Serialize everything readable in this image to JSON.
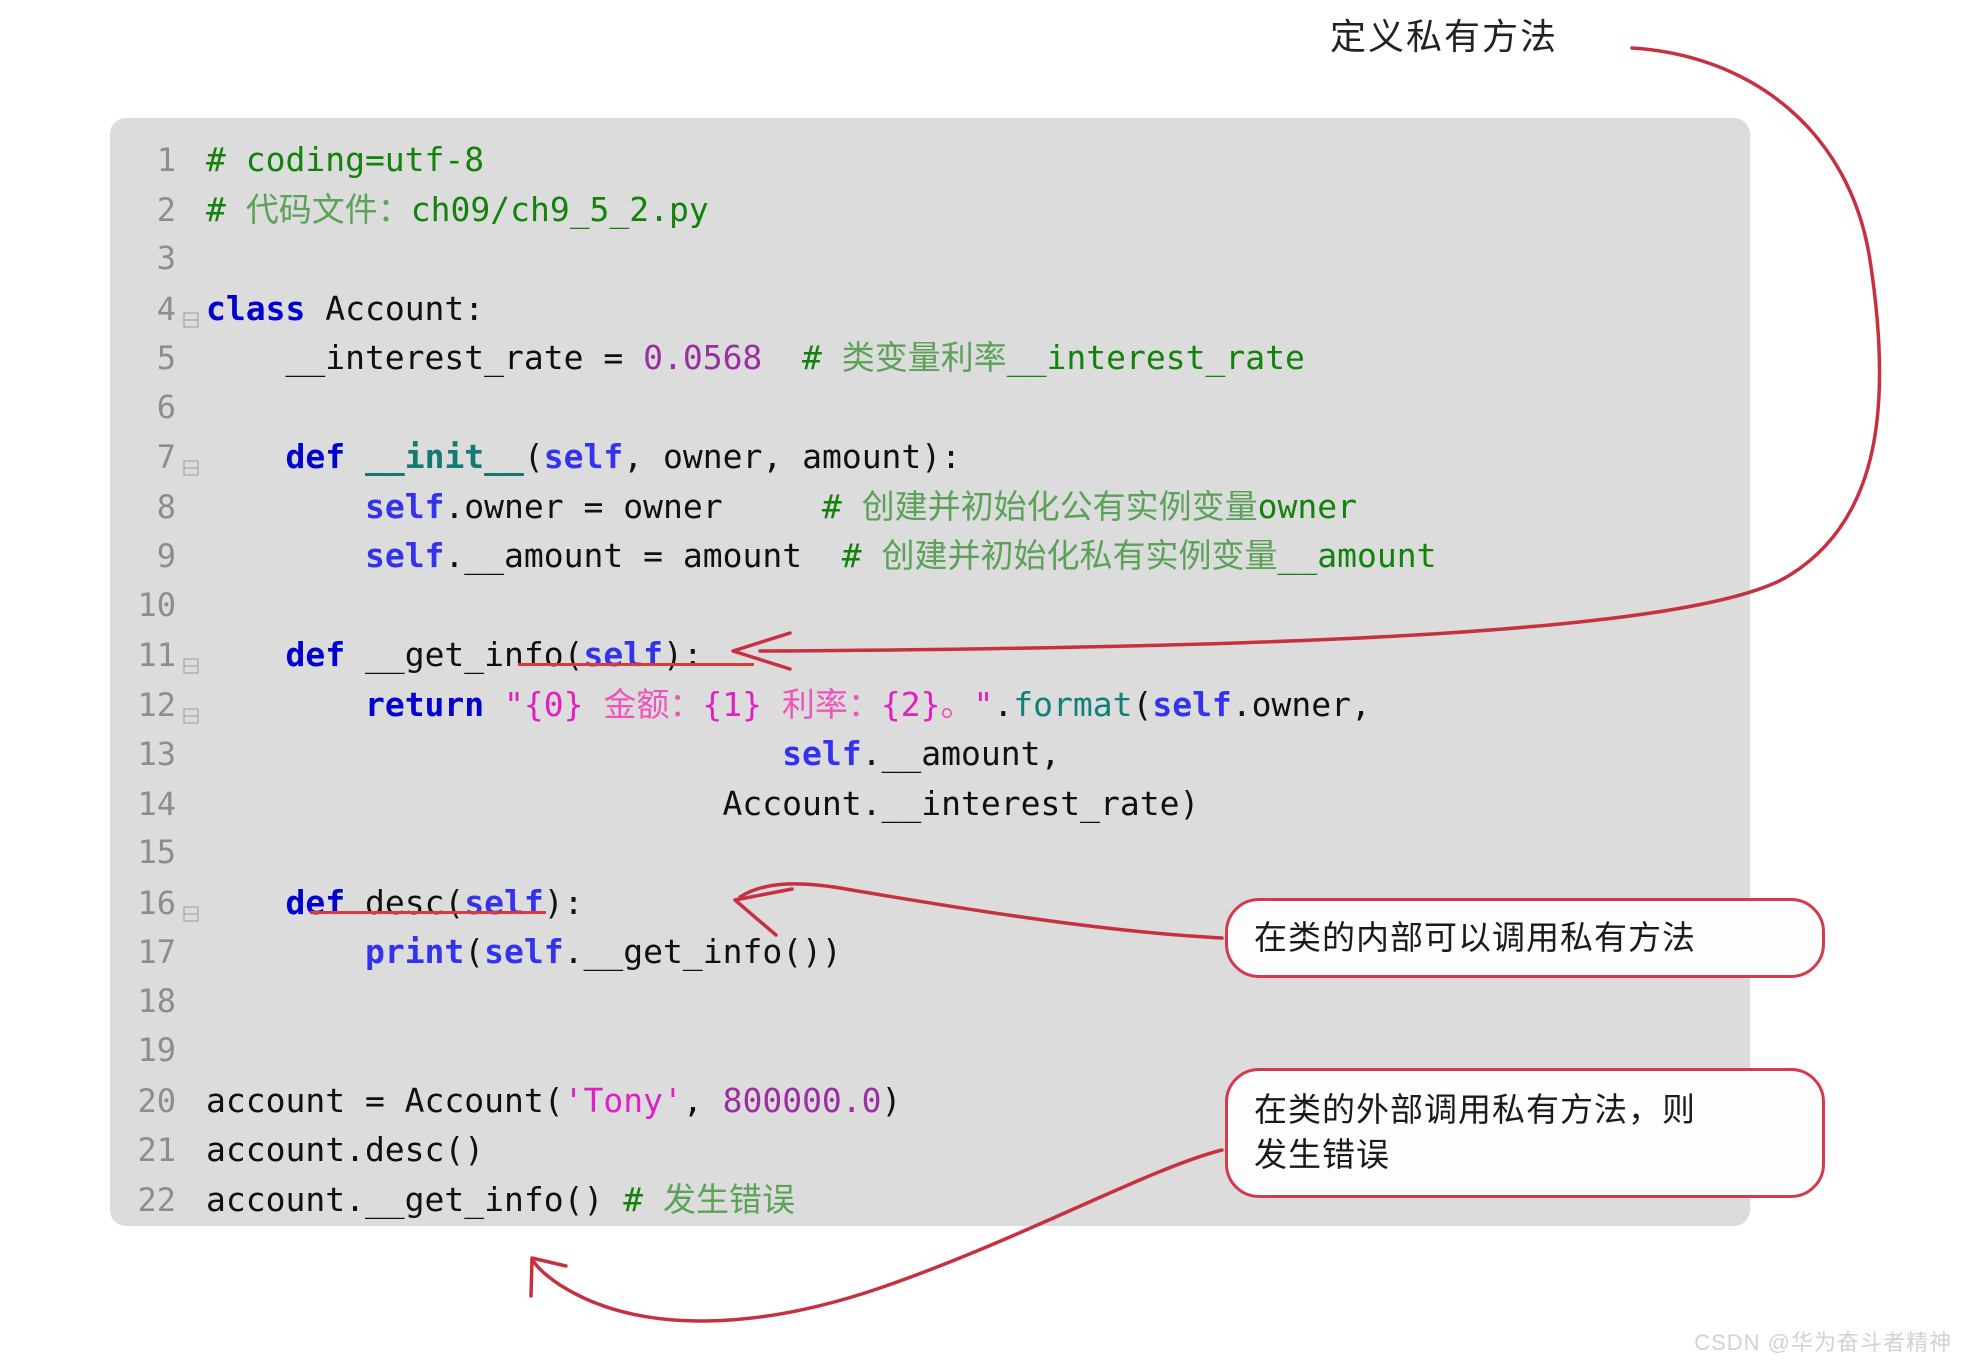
{
  "annotations": {
    "top_label": "定义私有方法",
    "callout_inner": "在类的内部可以调用私有方法",
    "callout_outer_line1": "在类的外部调用私有方法，则",
    "callout_outer_line2": "发生错误"
  },
  "watermark": "CSDN @华为奋斗者精神",
  "colors": {
    "panel_bg": "#dcdcdc",
    "page_bg": "#ffffff",
    "arrow_red": "#d53a4c",
    "underline_red": "#d93a3a",
    "keyword_blue": "#0000d0",
    "comment_green": "#13820a",
    "string_magenta": "#e020c0",
    "number_purple": "#9b2ea0",
    "self_blue": "#3333ee",
    "dunder_teal": "#117a72",
    "lineno_gray": "#8d8d8d"
  },
  "code": {
    "language": "python",
    "lines": [
      {
        "n": "1",
        "fold": false,
        "tokens": [
          {
            "t": "# coding=utf-8",
            "c": "t-comment"
          }
        ]
      },
      {
        "n": "2",
        "fold": false,
        "tokens": [
          {
            "t": "# ",
            "c": "t-comment"
          },
          {
            "t": "代码文件：",
            "c": "t-comment-cjk cjk"
          },
          {
            "t": "ch09/ch9_5_2.py",
            "c": "t-comment"
          }
        ]
      },
      {
        "n": "3",
        "fold": false,
        "tokens": []
      },
      {
        "n": "4",
        "fold": true,
        "tokens": [
          {
            "t": "class",
            "c": "t-kw"
          },
          {
            "t": " ",
            "c": "t-plain"
          },
          {
            "t": "Account",
            "c": "t-plain"
          },
          {
            "t": ":",
            "c": "t-plain"
          }
        ]
      },
      {
        "n": "5",
        "fold": false,
        "tokens": [
          {
            "t": "    __interest_rate = ",
            "c": "t-plain"
          },
          {
            "t": "0.0568",
            "c": "t-num"
          },
          {
            "t": "  # ",
            "c": "t-comment"
          },
          {
            "t": "类变量利率",
            "c": "t-comment-cjk cjk"
          },
          {
            "t": "__interest_rate",
            "c": "t-comment"
          }
        ]
      },
      {
        "n": "6",
        "fold": false,
        "tokens": []
      },
      {
        "n": "7",
        "fold": true,
        "tokens": [
          {
            "t": "    ",
            "c": "t-plain"
          },
          {
            "t": "def",
            "c": "t-kw"
          },
          {
            "t": " ",
            "c": "t-plain"
          },
          {
            "t": "__init__",
            "c": "t-dunder"
          },
          {
            "t": "(",
            "c": "t-plain"
          },
          {
            "t": "self",
            "c": "t-self"
          },
          {
            "t": ", owner, amount):",
            "c": "t-plain"
          }
        ]
      },
      {
        "n": "8",
        "fold": false,
        "tokens": [
          {
            "t": "        ",
            "c": "t-plain"
          },
          {
            "t": "self",
            "c": "t-self"
          },
          {
            "t": ".owner = owner",
            "c": "t-plain"
          },
          {
            "t": "     # ",
            "c": "t-comment"
          },
          {
            "t": "创建并初始化公有实例变量",
            "c": "t-comment-cjk cjk"
          },
          {
            "t": "owner",
            "c": "t-comment"
          }
        ]
      },
      {
        "n": "9",
        "fold": false,
        "tokens": [
          {
            "t": "        ",
            "c": "t-plain"
          },
          {
            "t": "self",
            "c": "t-self"
          },
          {
            "t": ".__amount = amount",
            "c": "t-plain"
          },
          {
            "t": "  # ",
            "c": "t-comment"
          },
          {
            "t": "创建并初始化私有实例变量",
            "c": "t-comment-cjk cjk"
          },
          {
            "t": "__amount",
            "c": "t-comment"
          }
        ]
      },
      {
        "n": "10",
        "fold": false,
        "tokens": []
      },
      {
        "n": "11",
        "fold": true,
        "tokens": [
          {
            "t": "    ",
            "c": "t-plain"
          },
          {
            "t": "def",
            "c": "t-kw"
          },
          {
            "t": " __get_info(",
            "c": "t-plain"
          },
          {
            "t": "self",
            "c": "t-self"
          },
          {
            "t": "):",
            "c": "t-plain"
          }
        ]
      },
      {
        "n": "12",
        "fold": true,
        "tokens": [
          {
            "t": "        ",
            "c": "t-plain"
          },
          {
            "t": "return",
            "c": "t-kw"
          },
          {
            "t": " ",
            "c": "t-plain"
          },
          {
            "t": "\"{0} ",
            "c": "t-str"
          },
          {
            "t": "金额：",
            "c": "t-cjkstr cjk"
          },
          {
            "t": "{1} ",
            "c": "t-str"
          },
          {
            "t": "利率：",
            "c": "t-cjkstr cjk"
          },
          {
            "t": "{2}",
            "c": "t-str"
          },
          {
            "t": "。",
            "c": "t-cjkstr cjk"
          },
          {
            "t": "\"",
            "c": "t-str"
          },
          {
            "t": ".",
            "c": "t-plain"
          },
          {
            "t": "format",
            "c": "t-fn"
          },
          {
            "t": "(",
            "c": "t-plain"
          },
          {
            "t": "self",
            "c": "t-self"
          },
          {
            "t": ".owner,",
            "c": "t-plain"
          }
        ]
      },
      {
        "n": "13",
        "fold": false,
        "tokens": [
          {
            "t": "                             ",
            "c": "t-plain"
          },
          {
            "t": "self",
            "c": "t-self"
          },
          {
            "t": ".__amount,",
            "c": "t-plain"
          }
        ]
      },
      {
        "n": "14",
        "fold": false,
        "tokens": [
          {
            "t": "                          Account.__interest_rate)",
            "c": "t-plain"
          }
        ]
      },
      {
        "n": "15",
        "fold": false,
        "tokens": []
      },
      {
        "n": "16",
        "fold": true,
        "tokens": [
          {
            "t": "    ",
            "c": "t-plain"
          },
          {
            "t": "def",
            "c": "t-kw"
          },
          {
            "t": " desc(",
            "c": "t-plain"
          },
          {
            "t": "self",
            "c": "t-self"
          },
          {
            "t": "):",
            "c": "t-plain"
          }
        ]
      },
      {
        "n": "17",
        "fold": false,
        "tokens": [
          {
            "t": "        ",
            "c": "t-plain"
          },
          {
            "t": "print",
            "c": "t-self"
          },
          {
            "t": "(",
            "c": "t-plain"
          },
          {
            "t": "self",
            "c": "t-self"
          },
          {
            "t": ".__get_info())",
            "c": "t-plain"
          }
        ]
      },
      {
        "n": "18",
        "fold": false,
        "tokens": []
      },
      {
        "n": "19",
        "fold": false,
        "tokens": []
      },
      {
        "n": "20",
        "fold": false,
        "tokens": [
          {
            "t": "account = Account(",
            "c": "t-plain"
          },
          {
            "t": "'Tony'",
            "c": "t-str"
          },
          {
            "t": ", ",
            "c": "t-plain"
          },
          {
            "t": "800000.0",
            "c": "t-num"
          },
          {
            "t": ")",
            "c": "t-plain"
          }
        ]
      },
      {
        "n": "21",
        "fold": false,
        "tokens": [
          {
            "t": "account.desc()",
            "c": "t-plain"
          }
        ]
      },
      {
        "n": "22",
        "fold": false,
        "tokens": [
          {
            "t": "account.__get_info() ",
            "c": "t-plain"
          },
          {
            "t": "# ",
            "c": "t-comment"
          },
          {
            "t": "发生错误",
            "c": "t-comment-cjk cjk"
          }
        ]
      }
    ]
  }
}
